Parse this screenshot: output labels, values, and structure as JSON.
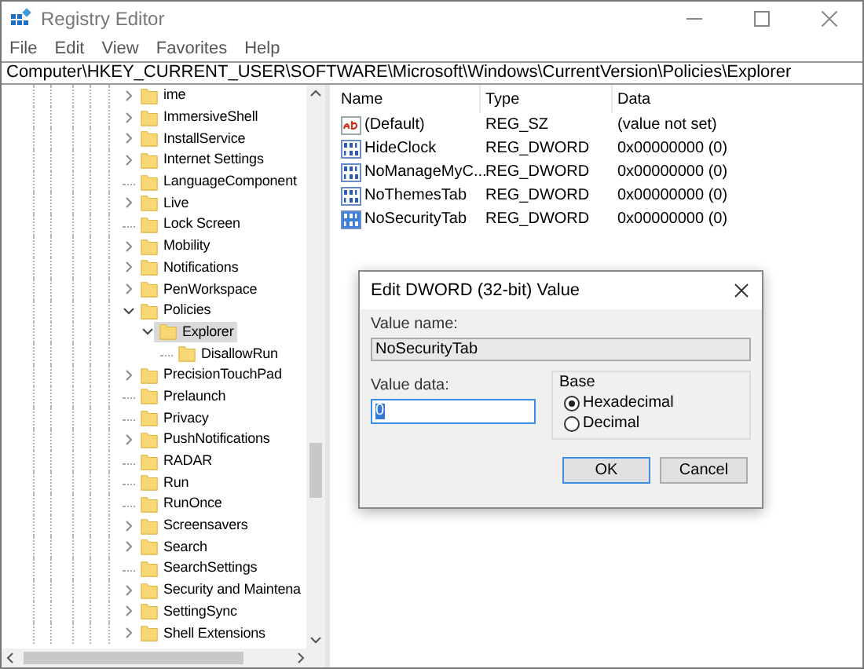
{
  "window": {
    "title": "Registry Editor"
  },
  "menu": [
    "File",
    "Edit",
    "View",
    "Favorites",
    "Help"
  ],
  "address": "Computer\\HKEY_CURRENT_USER\\SOFTWARE\\Microsoft\\Windows\\CurrentVersion\\Policies\\Explorer",
  "tree": [
    {
      "label": "ime",
      "kind": "branch",
      "expanded": false,
      "selected": false
    },
    {
      "label": "ImmersiveShell",
      "kind": "branch",
      "expanded": false,
      "selected": false
    },
    {
      "label": "InstallService",
      "kind": "branch",
      "expanded": false,
      "selected": false
    },
    {
      "label": "Internet Settings",
      "kind": "branch",
      "expanded": false,
      "selected": false
    },
    {
      "label": "LanguageComponent",
      "kind": "leaf",
      "selected": false
    },
    {
      "label": "Live",
      "kind": "branch",
      "expanded": false,
      "selected": false
    },
    {
      "label": "Lock Screen",
      "kind": "leaf",
      "selected": false
    },
    {
      "label": "Mobility",
      "kind": "branch",
      "expanded": false,
      "selected": false
    },
    {
      "label": "Notifications",
      "kind": "branch",
      "expanded": false,
      "selected": false
    },
    {
      "label": "PenWorkspace",
      "kind": "branch",
      "expanded": false,
      "selected": false
    },
    {
      "label": "Policies",
      "kind": "branch",
      "expanded": true,
      "selected": false,
      "children": [
        {
          "label": "Explorer",
          "kind": "branch",
          "expanded": true,
          "selected": true,
          "children": [
            {
              "label": "DisallowRun",
              "kind": "leaf",
              "selected": false
            }
          ]
        }
      ]
    },
    {
      "label": "PrecisionTouchPad",
      "kind": "branch",
      "expanded": false,
      "selected": false
    },
    {
      "label": "Prelaunch",
      "kind": "leaf",
      "selected": false
    },
    {
      "label": "Privacy",
      "kind": "leaf",
      "selected": false
    },
    {
      "label": "PushNotifications",
      "kind": "branch",
      "expanded": false,
      "selected": false
    },
    {
      "label": "RADAR",
      "kind": "leaf",
      "selected": false
    },
    {
      "label": "Run",
      "kind": "leaf",
      "selected": false
    },
    {
      "label": "RunOnce",
      "kind": "leaf",
      "selected": false
    },
    {
      "label": "Screensavers",
      "kind": "branch",
      "expanded": false,
      "selected": false
    },
    {
      "label": "Search",
      "kind": "branch",
      "expanded": false,
      "selected": false
    },
    {
      "label": "SearchSettings",
      "kind": "leaf",
      "selected": false
    },
    {
      "label": "Security and Maintena",
      "kind": "branch",
      "expanded": false,
      "selected": false
    },
    {
      "label": "SettingSync",
      "kind": "branch",
      "expanded": false,
      "selected": false
    },
    {
      "label": "Shell Extensions",
      "kind": "branch",
      "expanded": false,
      "selected": false
    }
  ],
  "values": {
    "columns": [
      "Name",
      "Type",
      "Data"
    ],
    "rows": [
      {
        "kind": "string",
        "name": "(Default)",
        "type": "REG_SZ",
        "data": "(value not set)",
        "selected": false
      },
      {
        "kind": "dword",
        "name": "HideClock",
        "type": "REG_DWORD",
        "data": "0x00000000 (0)",
        "selected": false
      },
      {
        "kind": "dword",
        "name": "NoManageMyC...",
        "type": "REG_DWORD",
        "data": "0x00000000 (0)",
        "selected": false
      },
      {
        "kind": "dword",
        "name": "NoThemesTab",
        "type": "REG_DWORD",
        "data": "0x00000000 (0)",
        "selected": false
      },
      {
        "kind": "dword",
        "name": "NoSecurityTab",
        "type": "REG_DWORD",
        "data": "0x00000000 (0)",
        "selected": true
      }
    ]
  },
  "dialog": {
    "title": "Edit DWORD (32-bit) Value",
    "value_name_label": "Value name:",
    "value_name": "NoSecurityTab",
    "value_data_label": "Value data:",
    "value_data": "0",
    "base_label": "Base",
    "base_options": [
      {
        "label": "Hexadecimal",
        "selected": true
      },
      {
        "label": "Decimal",
        "selected": false
      }
    ],
    "buttons": [
      "OK",
      "Cancel"
    ]
  }
}
